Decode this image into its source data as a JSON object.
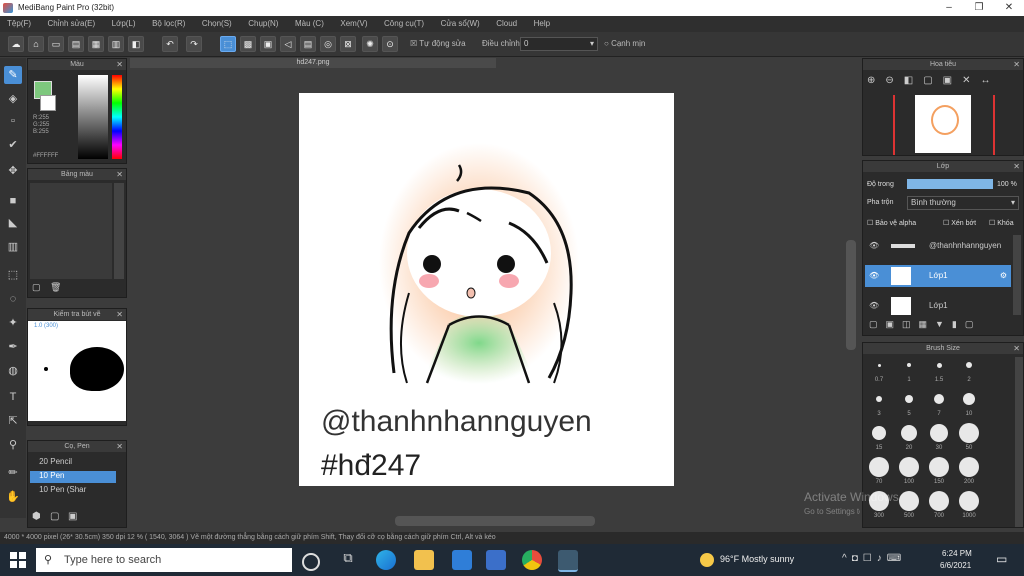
{
  "app": {
    "title": "MediBang Paint Pro (32bit)",
    "window_controls": {
      "minimize": "–",
      "maximize": "❐",
      "close": "✕"
    }
  },
  "menu": [
    "Tệp(F)",
    "Chỉnh sửa(E)",
    "Lớp(L)",
    "Bộ lọc(R)",
    "Chọn(S)",
    "Chụp(N)",
    "Màu (C)",
    "Xem(V)",
    "Công cụ(T)",
    "Cửa sổ(W)",
    "Cloud",
    "Help"
  ],
  "toolbar": {
    "correction_label": "Tự động sửa",
    "adjust_label": "Điều chỉnh",
    "adjust_value": "0",
    "antialias_label": "Cạnh mịn"
  },
  "color_panel": {
    "title": "Màu",
    "values": [
      "R:255",
      "G:255",
      "B:255"
    ],
    "hex": "#FFFFFF"
  },
  "color_palette_panel": {
    "title": "Bảng màu"
  },
  "brush_control_panel": {
    "title": "Kiểm tra bút vẽ",
    "scale": "1.0 (300)"
  },
  "brush_panel": {
    "title": "Cọ, Pen",
    "items": [
      {
        "size": "20",
        "name": "Pencil"
      },
      {
        "size": "10",
        "name": "Pen"
      },
      {
        "size": "10",
        "name": "Pen (Shar"
      }
    ]
  },
  "canvas_tab": {
    "filename": "hd247.png"
  },
  "canvas": {
    "handle_text": "@thanhnhannguyen",
    "tag_text": "#hđ247"
  },
  "navigator_panel": {
    "title": "Hoa tiêu"
  },
  "layer_panel": {
    "title": "Lớp",
    "opacity_label": "Độ trong",
    "opacity_value": "100 %",
    "opacity_fraction": 1.0,
    "blend_label": "Pha trộn",
    "blend_value": "Bình thường",
    "protect_alpha": "Bảo vệ alpha",
    "clipping": "Xén bớt",
    "lock": "Khóa",
    "layers": [
      {
        "name": "@thanhnhannguyen",
        "active": false
      },
      {
        "name": "Lớp1",
        "active": true
      },
      {
        "name": "Lớp1",
        "active": false
      }
    ]
  },
  "brush_size_panel": {
    "title": "Brush Size",
    "rows": [
      [
        "0.7",
        "1",
        "1.5",
        "2"
      ],
      [
        "3",
        "5",
        "7",
        "10"
      ],
      [
        "15",
        "20",
        "30",
        "50"
      ],
      [
        "70",
        "100",
        "150",
        "200"
      ],
      [
        "300",
        "500",
        "700",
        "1000"
      ]
    ]
  },
  "watermark": {
    "line1": "Activate Windows",
    "line2": "Go to Settings to activate Windows."
  },
  "statusbar": {
    "text": "4000 * 4000 pixel  (26* 30.5cm)  350 dpi  12 %  ( 1540, 3064 )  Vẽ một đường thẳng bằng cách giữ phím Shift, Thay đổi cỡ cọ bằng cách giữ phím Ctrl, Alt và kéo"
  },
  "taskbar": {
    "search_placeholder": "Type here to search",
    "weather": "96°F  Mostly sunny",
    "time": "6:24 PM",
    "date": "6/6/2021"
  }
}
